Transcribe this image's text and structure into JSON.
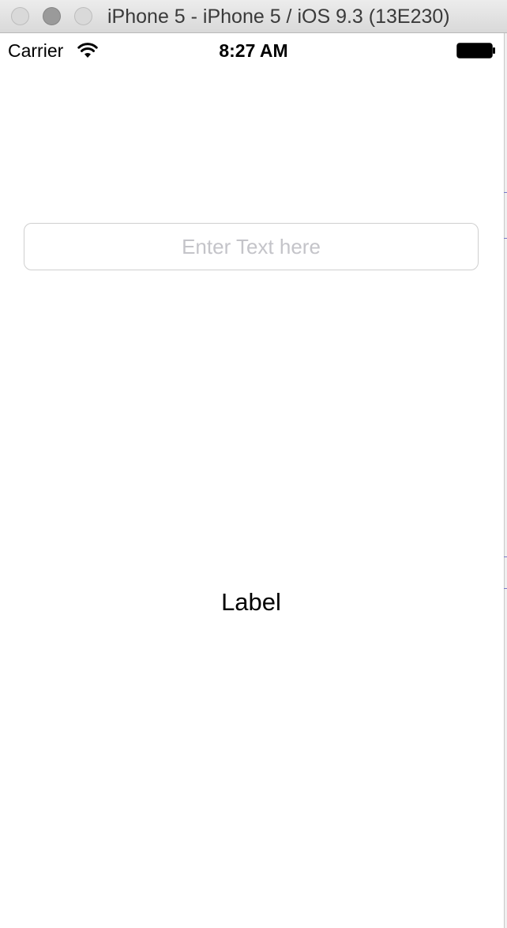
{
  "window": {
    "title": "iPhone 5 - iPhone 5 / iOS 9.3 (13E230)"
  },
  "statusbar": {
    "carrier": "Carrier",
    "time": "8:27 AM",
    "icons": [
      "wifi-icon",
      "battery-icon"
    ]
  },
  "text_field": {
    "value": "",
    "placeholder": "Enter Text here"
  },
  "label": {
    "text": "Label"
  },
  "colors": {
    "placeholder": "#c4c4c9",
    "field_border": "#cfcfcf",
    "background": "#ffffff"
  }
}
